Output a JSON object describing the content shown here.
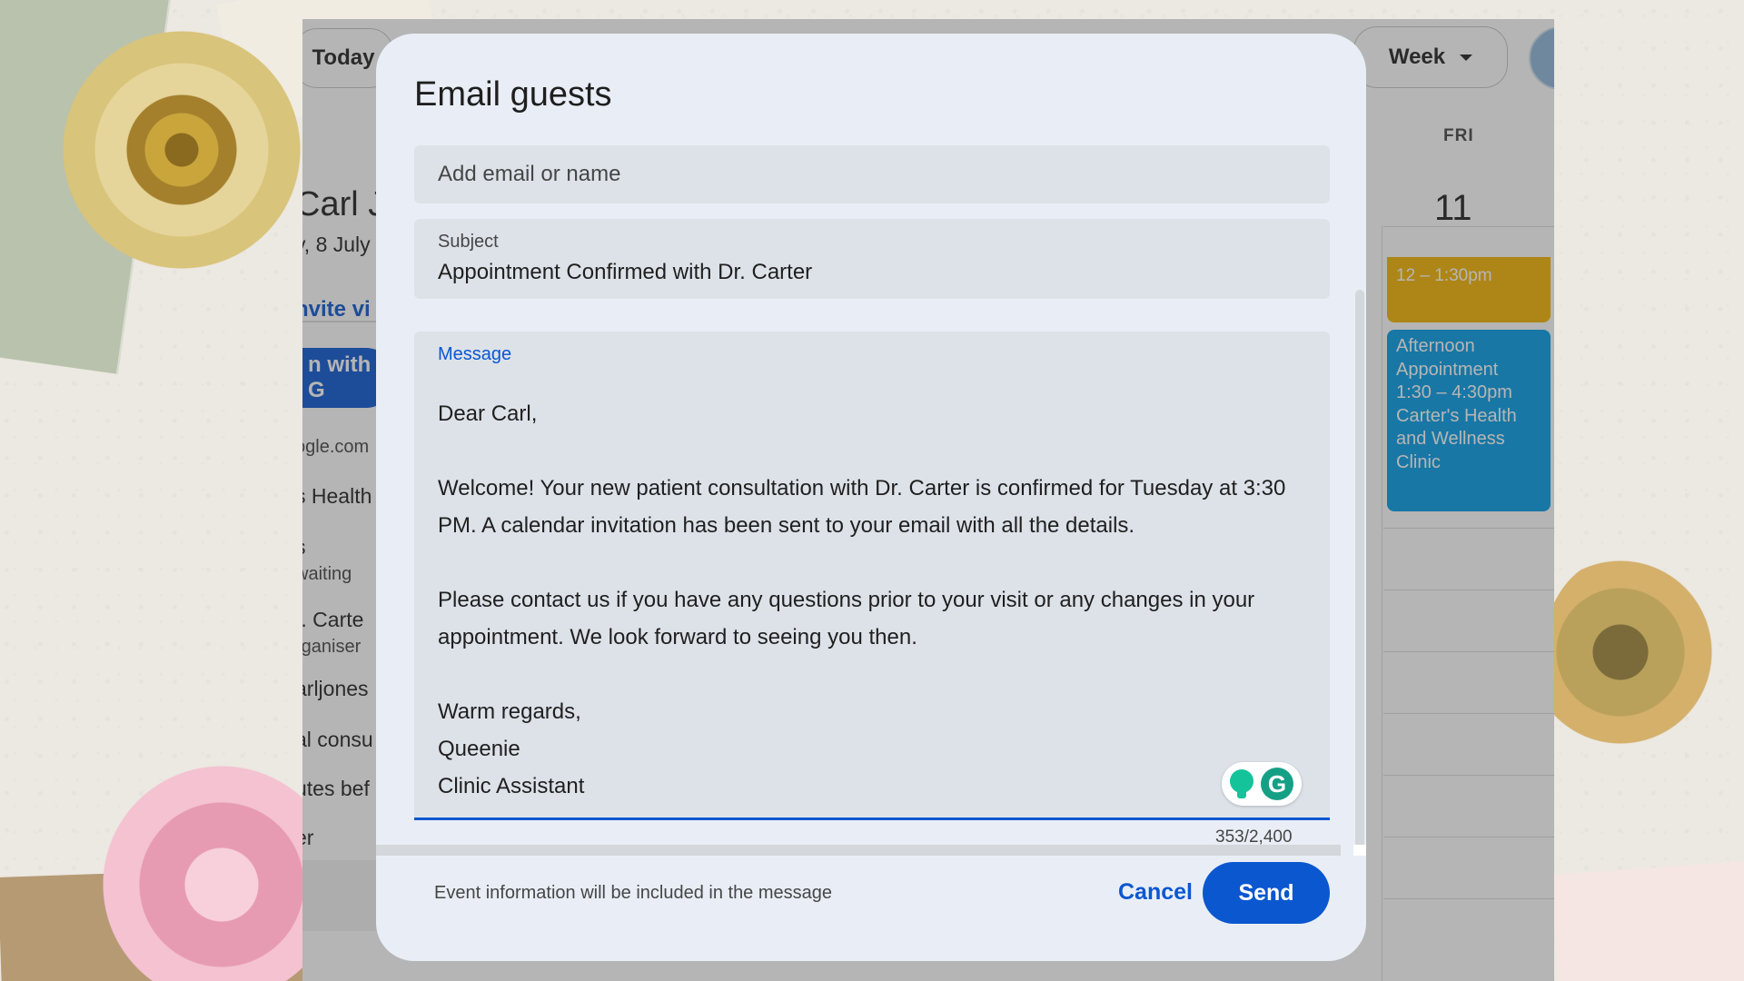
{
  "calendar": {
    "today_label": "Today",
    "view_label": "Week",
    "sidebar": {
      "event_title": "Carl Jo",
      "event_date": "y, 8 July",
      "invite_link": "nvite vi",
      "join_button": "n with G",
      "meet_link": "ogle.com",
      "location": "s Health",
      "guests_count": "s",
      "guests_status": "waiting",
      "organiser_name": "r. Carte",
      "organiser_role": "rganiser",
      "guest_email": "arljones",
      "description": "al consu",
      "reminder": "utes bef",
      "calendar_name": "er"
    },
    "day": {
      "name": "FRI",
      "number": "11"
    },
    "events": [
      {
        "lines": [
          "12 – 1:30pm"
        ],
        "color": "#f4b400"
      },
      {
        "lines": [
          "Afternoon",
          "Appointment",
          "1:30 – 4:30pm",
          "Carter's Health",
          "and Wellness",
          "Clinic"
        ],
        "color": "#039be5"
      }
    ]
  },
  "dialog": {
    "title": "Email guests",
    "to_placeholder": "Add email or name",
    "subject_label": "Subject",
    "subject_value": "Appointment Confirmed with Dr. Carter",
    "message_label": "Message",
    "message": {
      "greeting": "Dear Carl,",
      "paragraph1_line1": "Welcome! Your new patient consultation with Dr. Carter is confirmed for Tuesday at 3:30",
      "paragraph1_line2": "PM. A calendar invitation has been sent to your email with all the details.",
      "paragraph2_line1": "Please contact us if you have any questions prior to your visit or any changes in your",
      "paragraph2_line2": "appointment. We look forward to seeing you then.",
      "closing": "Warm regards,",
      "signature_name": "Queenie",
      "signature_title": "Clinic Assistant"
    },
    "grammarly_letter": "G",
    "char_count": "353/2,400",
    "footer_note": "Event information will be included in the message",
    "cancel_label": "Cancel",
    "send_label": "Send",
    "accent_color": "#0b57d0"
  }
}
